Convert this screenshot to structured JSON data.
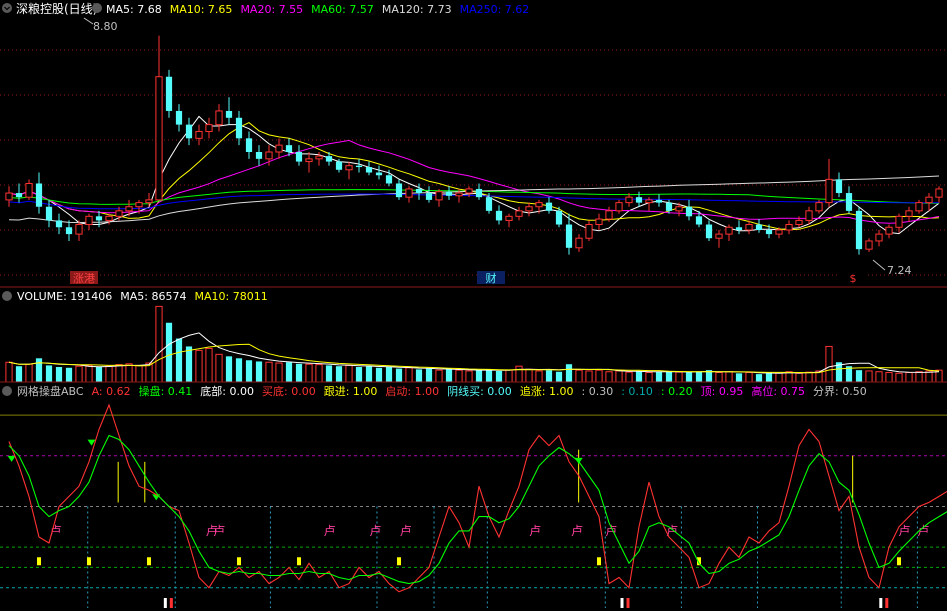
{
  "colors": {
    "bg": "#000000",
    "up": "#ff3232",
    "down": "#54fcfc",
    "frame": "#8b1a1a",
    "grid": "#8b1a1a",
    "white": "#ffffff",
    "yellow": "#ffff00",
    "magenta": "#ff00ff",
    "green": "#00ff00",
    "blue": "#0000ff",
    "ma120": "#dcdcdc",
    "label": "#c0c0c0"
  },
  "main": {
    "title": "深粮控股(日线)",
    "legend": [
      {
        "text": "MA5: 7.68",
        "color": "#ffffff"
      },
      {
        "text": "MA10: 7.65",
        "color": "#ffff00"
      },
      {
        "text": "MA20: 7.55",
        "color": "#ff00ff"
      },
      {
        "text": "MA60: 7.57",
        "color": "#00ff00"
      },
      {
        "text": "MA120: 7.73",
        "color": "#dcdcdc"
      },
      {
        "text": "MA250: 7.62",
        "color": "#0000ff"
      }
    ],
    "high_label": "8.80",
    "low_label": "7.24",
    "markers": [
      {
        "text": "涨港",
        "color": "#ff4040",
        "bg": "#8b1a1a",
        "x": 84
      },
      {
        "text": "财",
        "color": "#54fcfc",
        "bg": "#0a2060",
        "x": 491
      },
      {
        "text": "$",
        "color": "#ff3232",
        "bg": "#000000",
        "x": 853
      }
    ]
  },
  "volume": {
    "legend": [
      {
        "text": "VOLUME: 191406",
        "color": "#ffffff"
      },
      {
        "text": "MA5: 86574",
        "color": "#ffffff"
      },
      {
        "text": "MA10: 78011",
        "color": "#ffff00"
      }
    ]
  },
  "indicator": {
    "legend": [
      {
        "text": "网格操盘ABC",
        "color": "#c0c0c0"
      },
      {
        "text": "A: 0.62",
        "color": "#ff3232"
      },
      {
        "text": "操盘: 0.41",
        "color": "#00ff00"
      },
      {
        "text": "底部: 0.00",
        "color": "#ffffff"
      },
      {
        "text": "买底: 0.00",
        "color": "#ff3232"
      },
      {
        "text": "跟进: 1.00",
        "color": "#ffff00"
      },
      {
        "text": "启动: 1.00",
        "color": "#ff3232"
      },
      {
        "text": "阴线买: 0.00",
        "color": "#54fcfc"
      },
      {
        "text": "追涨: 1.00",
        "color": "#ffff00"
      },
      {
        "text": ": 0.30",
        "color": "#c0c0c0"
      },
      {
        "text": ": 0.10",
        "color": "#00aaaa"
      },
      {
        "text": ": 0.20",
        "color": "#00ff00"
      },
      {
        "text": "顶: 0.95",
        "color": "#ff00ff"
      },
      {
        "text": "高位: 0.75",
        "color": "#ff00ff"
      },
      {
        "text": "分界: 0.50",
        "color": "#c0c0c0"
      }
    ],
    "label_fu": "卢"
  },
  "chart_data": [
    {
      "type": "candlestick",
      "title": "深粮控股(日线)",
      "ylim": [
        7.0,
        8.9
      ],
      "candles": [
        [
          7.6,
          7.7,
          7.55,
          7.65
        ],
        [
          7.65,
          7.72,
          7.58,
          7.62
        ],
        [
          7.62,
          7.75,
          7.6,
          7.72
        ],
        [
          7.72,
          7.8,
          7.5,
          7.55
        ],
        [
          7.55,
          7.6,
          7.4,
          7.45
        ],
        [
          7.45,
          7.5,
          7.35,
          7.4
        ],
        [
          7.4,
          7.45,
          7.3,
          7.35
        ],
        [
          7.35,
          7.45,
          7.3,
          7.42
        ],
        [
          7.42,
          7.5,
          7.38,
          7.48
        ],
        [
          7.48,
          7.52,
          7.4,
          7.45
        ],
        [
          7.45,
          7.5,
          7.42,
          7.48
        ],
        [
          7.48,
          7.55,
          7.45,
          7.52
        ],
        [
          7.52,
          7.6,
          7.48,
          7.55
        ],
        [
          7.55,
          7.6,
          7.5,
          7.58
        ],
        [
          7.58,
          7.65,
          7.55,
          7.6
        ],
        [
          7.6,
          8.8,
          7.6,
          8.5
        ],
        [
          8.5,
          8.55,
          8.2,
          8.25
        ],
        [
          8.25,
          8.3,
          8.1,
          8.15
        ],
        [
          8.15,
          8.2,
          8.0,
          8.05
        ],
        [
          8.05,
          8.15,
          8.0,
          8.1
        ],
        [
          8.1,
          8.2,
          8.05,
          8.15
        ],
        [
          8.15,
          8.3,
          8.1,
          8.25
        ],
        [
          8.25,
          8.35,
          8.15,
          8.2
        ],
        [
          8.2,
          8.25,
          8.0,
          8.05
        ],
        [
          8.05,
          8.1,
          7.9,
          7.95
        ],
        [
          7.95,
          8.0,
          7.85,
          7.9
        ],
        [
          7.9,
          8.0,
          7.85,
          7.95
        ],
        [
          7.95,
          8.05,
          7.9,
          8.0
        ],
        [
          8.0,
          8.05,
          7.92,
          7.95
        ],
        [
          7.95,
          8.0,
          7.85,
          7.88
        ],
        [
          7.88,
          7.95,
          7.8,
          7.9
        ],
        [
          7.9,
          7.95,
          7.85,
          7.92
        ],
        [
          7.92,
          7.95,
          7.85,
          7.88
        ],
        [
          7.88,
          7.9,
          7.8,
          7.82
        ],
        [
          7.82,
          7.88,
          7.75,
          7.85
        ],
        [
          7.85,
          7.9,
          7.8,
          7.84
        ],
        [
          7.84,
          7.88,
          7.78,
          7.8
        ],
        [
          7.8,
          7.85,
          7.75,
          7.78
        ],
        [
          7.78,
          7.82,
          7.7,
          7.72
        ],
        [
          7.72,
          7.75,
          7.6,
          7.62
        ],
        [
          7.62,
          7.7,
          7.58,
          7.68
        ],
        [
          7.68,
          7.72,
          7.6,
          7.65
        ],
        [
          7.65,
          7.7,
          7.58,
          7.6
        ],
        [
          7.6,
          7.68,
          7.55,
          7.66
        ],
        [
          7.66,
          7.7,
          7.6,
          7.63
        ],
        [
          7.63,
          7.68,
          7.58,
          7.65
        ],
        [
          7.65,
          7.7,
          7.62,
          7.68
        ],
        [
          7.68,
          7.72,
          7.6,
          7.62
        ],
        [
          7.62,
          7.65,
          7.5,
          7.52
        ],
        [
          7.52,
          7.56,
          7.42,
          7.45
        ],
        [
          7.45,
          7.5,
          7.4,
          7.48
        ],
        [
          7.48,
          7.55,
          7.45,
          7.52
        ],
        [
          7.52,
          7.58,
          7.48,
          7.55
        ],
        [
          7.55,
          7.6,
          7.5,
          7.58
        ],
        [
          7.58,
          7.62,
          7.5,
          7.52
        ],
        [
          7.52,
          7.55,
          7.4,
          7.42
        ],
        [
          7.42,
          7.5,
          7.2,
          7.25
        ],
        [
          7.25,
          7.35,
          7.22,
          7.32
        ],
        [
          7.32,
          7.45,
          7.3,
          7.42
        ],
        [
          7.42,
          7.5,
          7.38,
          7.46
        ],
        [
          7.46,
          7.55,
          7.44,
          7.52
        ],
        [
          7.52,
          7.6,
          7.5,
          7.58
        ],
        [
          7.58,
          7.65,
          7.55,
          7.62
        ],
        [
          7.62,
          7.66,
          7.55,
          7.58
        ],
        [
          7.58,
          7.62,
          7.52,
          7.6
        ],
        [
          7.6,
          7.64,
          7.55,
          7.58
        ],
        [
          7.58,
          7.6,
          7.5,
          7.52
        ],
        [
          7.52,
          7.58,
          7.48,
          7.55
        ],
        [
          7.55,
          7.6,
          7.45,
          7.48
        ],
        [
          7.48,
          7.52,
          7.4,
          7.42
        ],
        [
          7.42,
          7.45,
          7.3,
          7.32
        ],
        [
          7.32,
          7.38,
          7.25,
          7.35
        ],
        [
          7.35,
          7.42,
          7.3,
          7.4
        ],
        [
          7.4,
          7.45,
          7.35,
          7.38
        ],
        [
          7.38,
          7.45,
          7.35,
          7.42
        ],
        [
          7.42,
          7.46,
          7.36,
          7.38
        ],
        [
          7.38,
          7.42,
          7.32,
          7.35
        ],
        [
          7.35,
          7.4,
          7.32,
          7.38
        ],
        [
          7.38,
          7.45,
          7.35,
          7.42
        ],
        [
          7.42,
          7.48,
          7.4,
          7.45
        ],
        [
          7.45,
          7.55,
          7.42,
          7.52
        ],
        [
          7.52,
          7.6,
          7.5,
          7.58
        ],
        [
          7.58,
          7.9,
          7.55,
          7.75
        ],
        [
          7.75,
          7.8,
          7.62,
          7.65
        ],
        [
          7.65,
          7.7,
          7.5,
          7.52
        ],
        [
          7.52,
          7.55,
          7.2,
          7.24
        ],
        [
          7.24,
          7.32,
          7.22,
          7.3
        ],
        [
          7.3,
          7.38,
          7.26,
          7.35
        ],
        [
          7.35,
          7.42,
          7.32,
          7.4
        ],
        [
          7.4,
          7.5,
          7.36,
          7.48
        ],
        [
          7.48,
          7.55,
          7.44,
          7.52
        ],
        [
          7.52,
          7.6,
          7.5,
          7.58
        ],
        [
          7.58,
          7.65,
          7.52,
          7.62
        ],
        [
          7.62,
          7.7,
          7.58,
          7.68
        ]
      ]
    },
    {
      "type": "bar",
      "title": "VOLUME",
      "ylim": [
        0,
        200000
      ],
      "values": [
        50000,
        40000,
        45000,
        60000,
        42000,
        38000,
        36000,
        40000,
        42000,
        38000,
        40000,
        44000,
        46000,
        42000,
        48000,
        191406,
        150000,
        110000,
        90000,
        80000,
        85000,
        70000,
        65000,
        60000,
        55000,
        52000,
        50000,
        48000,
        50000,
        46000,
        45000,
        44000,
        42000,
        40000,
        42000,
        38000,
        40000,
        36000,
        38000,
        34000,
        36000,
        32000,
        34000,
        30000,
        32000,
        30000,
        28000,
        30000,
        32000,
        28000,
        30000,
        40000,
        32000,
        28000,
        30000,
        26000,
        45000,
        30000,
        28000,
        30000,
        26000,
        28000,
        25000,
        27000,
        24000,
        26000,
        28000,
        25000,
        24000,
        26000,
        30000,
        24000,
        26000,
        22000,
        24000,
        20000,
        22000,
        24000,
        26000,
        22000,
        25000,
        28000,
        90000,
        50000,
        40000,
        30000,
        28000,
        26000,
        24000,
        22000,
        24000,
        26000,
        28000,
        30000
      ]
    },
    {
      "type": "line",
      "title": "网格操盘ABC",
      "ylim": [
        0,
        1
      ],
      "series": [
        {
          "name": "A",
          "values": [
            0.82,
            0.7,
            0.55,
            0.35,
            0.32,
            0.5,
            0.55,
            0.6,
            0.72,
            0.88,
            1.0,
            0.85,
            0.7,
            0.6,
            0.58,
            0.55,
            0.5,
            0.48,
            0.32,
            0.15,
            0.1,
            0.18,
            0.16,
            0.2,
            0.15,
            0.18,
            0.12,
            0.15,
            0.2,
            0.14,
            0.22,
            0.15,
            0.18,
            0.1,
            0.12,
            0.2,
            0.15,
            0.18,
            0.12,
            0.08,
            0.1,
            0.15,
            0.2,
            0.35,
            0.5,
            0.42,
            0.3,
            0.6,
            0.45,
            0.35,
            0.48,
            0.6,
            0.78,
            0.85,
            0.8,
            0.85,
            0.72,
            0.65,
            0.55,
            0.45,
            0.12,
            0.15,
            0.1,
            0.4,
            0.62,
            0.45,
            0.35,
            0.3,
            0.25,
            0.1,
            0.12,
            0.22,
            0.3,
            0.25,
            0.35,
            0.32,
            0.38,
            0.42,
            0.6,
            0.8,
            0.88,
            0.82,
            0.65,
            0.48,
            0.55,
            0.3,
            0.15,
            0.1,
            0.3,
            0.4,
            0.45,
            0.5,
            0.52,
            0.55,
            0.58,
            0.62
          ]
        },
        {
          "name": "操盘",
          "values": [
            0.8,
            0.75,
            0.65,
            0.5,
            0.45,
            0.48,
            0.5,
            0.55,
            0.62,
            0.75,
            0.85,
            0.83,
            0.78,
            0.7,
            0.62,
            0.55,
            0.5,
            0.45,
            0.38,
            0.28,
            0.2,
            0.18,
            0.17,
            0.18,
            0.17,
            0.17,
            0.16,
            0.16,
            0.17,
            0.17,
            0.18,
            0.17,
            0.17,
            0.15,
            0.14,
            0.16,
            0.16,
            0.17,
            0.15,
            0.13,
            0.12,
            0.13,
            0.16,
            0.22,
            0.32,
            0.38,
            0.38,
            0.45,
            0.45,
            0.42,
            0.44,
            0.5,
            0.6,
            0.7,
            0.75,
            0.79,
            0.76,
            0.72,
            0.65,
            0.58,
            0.42,
            0.32,
            0.22,
            0.28,
            0.4,
            0.42,
            0.4,
            0.36,
            0.32,
            0.22,
            0.17,
            0.18,
            0.22,
            0.24,
            0.28,
            0.3,
            0.33,
            0.36,
            0.45,
            0.58,
            0.7,
            0.76,
            0.72,
            0.62,
            0.58,
            0.46,
            0.32,
            0.2,
            0.22,
            0.28,
            0.33,
            0.38,
            0.42,
            0.45,
            0.48,
            0.41
          ]
        }
      ],
      "reference_lines": [
        0.95,
        0.75,
        0.5,
        0.3,
        0.2,
        0.1
      ]
    }
  ]
}
